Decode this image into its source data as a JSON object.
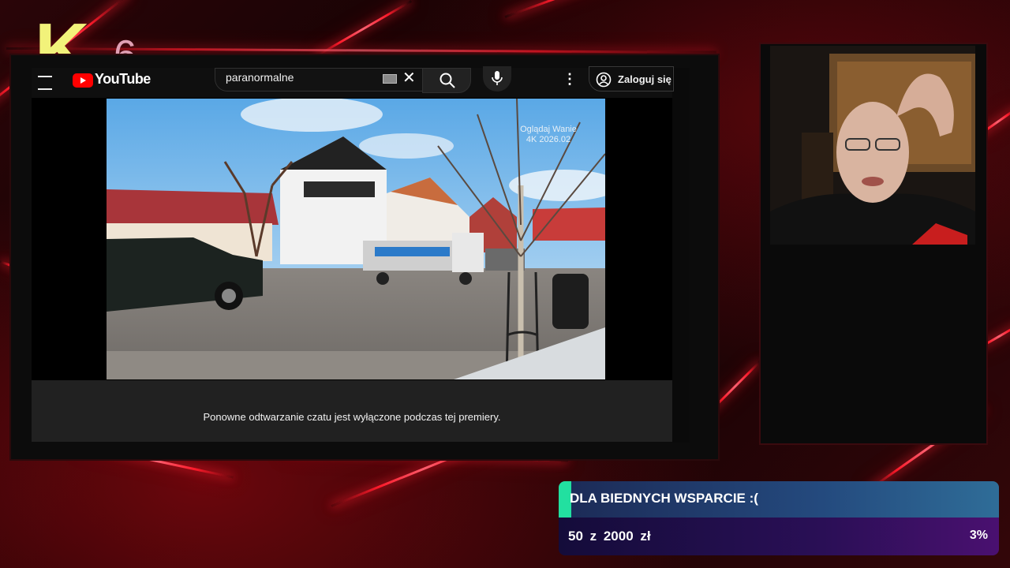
{
  "overlay": {
    "logo": {
      "letter": "K",
      "number": "6"
    }
  },
  "youtube": {
    "logo_text": "YouTube",
    "search": {
      "value": "paranormalne"
    },
    "login_label": "Zaloguj się",
    "chat_message": "Ponowne odtwarzanie czatu jest wyłączone podczas tej premiery.",
    "video_watermark": {
      "line1": "Oglądaj Wanie",
      "line2": "4K 2026.02"
    }
  },
  "donation": {
    "title": "DLA BIEDNYCH WSPARCIE :(",
    "amount_text": "50 z 2000 zł",
    "raised": 50,
    "goal": 2000,
    "percent_label": "3%",
    "accent_color": "#22e0a0"
  },
  "colors": {
    "background": "#1a0608",
    "streak": "#ff1a2a",
    "logo_k": "#f2f27a",
    "logo_6": "#e0a0b4"
  }
}
